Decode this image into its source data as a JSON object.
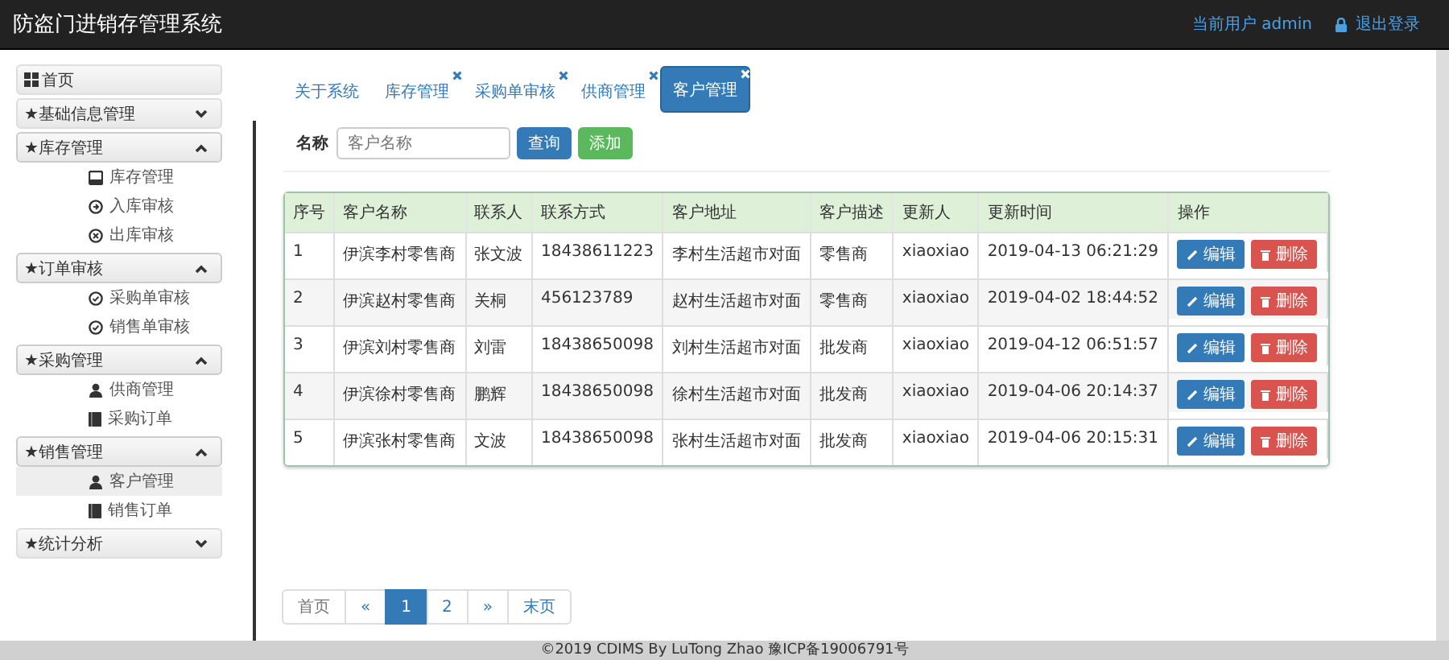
{
  "header": {
    "title": "防盗门进销存管理系统",
    "user": "当前用户 admin",
    "logout": "退出登录"
  },
  "sidebar": {
    "items": [
      {
        "label": "首页",
        "kind": "home"
      },
      {
        "label": "★基础信息管理",
        "kind": "group",
        "expanded": false
      },
      {
        "label": "★库存管理",
        "kind": "group",
        "expanded": true,
        "children": [
          {
            "label": "库存管理",
            "kind": "stock",
            "selected": false
          },
          {
            "label": "入库审核",
            "kind": "inbound",
            "selected": false
          },
          {
            "label": "出库审核",
            "kind": "outbound",
            "selected": false
          }
        ]
      },
      {
        "label": "★订单审核",
        "kind": "group",
        "expanded": true,
        "children": [
          {
            "label": "采购单审核",
            "kind": "review",
            "selected": false
          },
          {
            "label": "销售单审核",
            "kind": "review",
            "selected": false
          }
        ]
      },
      {
        "label": "★采购管理",
        "kind": "group",
        "expanded": true,
        "children": [
          {
            "label": "供商管理",
            "kind": "person",
            "selected": false
          },
          {
            "label": "采购订单",
            "kind": "ledger",
            "selected": false
          }
        ]
      },
      {
        "label": "★销售管理",
        "kind": "group",
        "expanded": true,
        "children": [
          {
            "label": "客户管理",
            "kind": "person",
            "selected": true
          },
          {
            "label": "销售订单",
            "kind": "ledger",
            "selected": false
          }
        ]
      },
      {
        "label": "★统计分析",
        "kind": "group",
        "expanded": false
      }
    ]
  },
  "tabs": [
    {
      "label": "关于系统",
      "closable": false,
      "selected": false
    },
    {
      "label": "库存管理",
      "closable": true,
      "selected": false
    },
    {
      "label": "采购单审核",
      "closable": true,
      "selected": false
    },
    {
      "label": "供商管理",
      "closable": true,
      "selected": false
    },
    {
      "label": "客户管理",
      "closable": true,
      "selected": true
    }
  ],
  "search": {
    "label": "名称",
    "placeholder": "客户名称",
    "query": "查询",
    "add": "添加"
  },
  "table": {
    "columns": [
      "序号",
      "客户名称",
      "联系人",
      "联系方式",
      "客户地址",
      "客户描述",
      "更新人",
      "更新时间",
      "操作"
    ],
    "rows": [
      {
        "cells": [
          "1",
          "伊滨李村零售商",
          "张文波",
          "18438611223",
          "李村生活超市对面",
          "零售商",
          "xiaoxiao",
          "2019-04-13 06:21:29"
        ],
        "edit": "编辑",
        "delete": "删除"
      },
      {
        "cells": [
          "2",
          "伊滨赵村零售商",
          "关桐",
          "456123789",
          "赵村生活超市对面",
          "零售商",
          "xiaoxiao",
          "2019-04-02 18:44:52"
        ],
        "edit": "编辑",
        "delete": "删除"
      },
      {
        "cells": [
          "3",
          "伊滨刘村零售商",
          "刘雷",
          "18438650098",
          "刘村生活超市对面",
          "批发商",
          "xiaoxiao",
          "2019-04-12 06:51:57"
        ],
        "edit": "编辑",
        "delete": "删除"
      },
      {
        "cells": [
          "4",
          "伊滨徐村零售商",
          "鹏辉",
          "18438650098",
          "徐村生活超市对面",
          "批发商",
          "xiaoxiao",
          "2019-04-06 20:14:37"
        ],
        "edit": "编辑",
        "delete": "删除"
      },
      {
        "cells": [
          "5",
          "伊滨张村零售商",
          "文波",
          "18438650098",
          "张村生活超市对面",
          "批发商",
          "xiaoxiao",
          "2019-04-06 20:15:31"
        ],
        "edit": "编辑",
        "delete": "删除"
      }
    ]
  },
  "pagination": [
    {
      "label": "首页",
      "selected": false
    },
    {
      "label": "«",
      "selected": false
    },
    {
      "label": "1",
      "selected": true
    },
    {
      "label": "2",
      "selected": false
    },
    {
      "label": "»",
      "selected": false
    },
    {
      "label": "末页",
      "selected": false
    }
  ],
  "footer": "©2019 CDIMS By LuTong Zhao 豫ICP备19006791号"
}
